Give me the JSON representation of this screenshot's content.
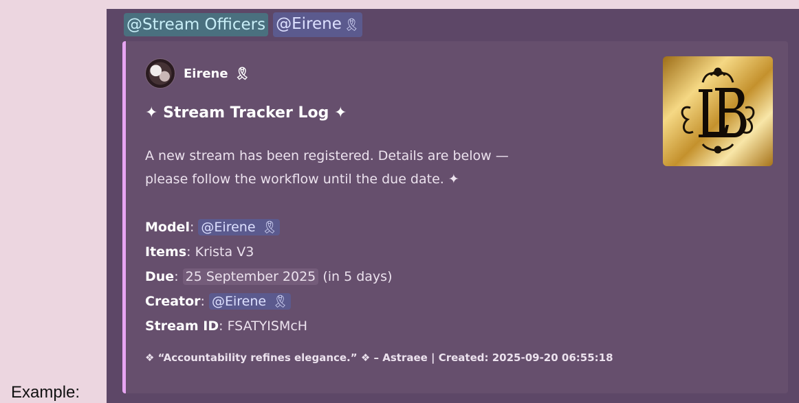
{
  "outer_label": "Example:",
  "top_mentions": {
    "role": "@Stream Officers",
    "user": "@Eirene",
    "user_badge": "🎗"
  },
  "embed": {
    "accent_color": "#e7a5f2",
    "author": {
      "name": "Eirene",
      "badge": "🎗"
    },
    "title": "✦ Stream Tracker Log ✦",
    "description_line1": "A new stream has been registered. Details are below —",
    "description_line2": "please follow the workflow until the due date. ✦",
    "fields": {
      "model_label": "Model",
      "model_value": "@Eirene",
      "model_badge": "🎗",
      "items_label": "Items",
      "items_value": "Krista V3",
      "due_label": "Due",
      "due_date": "25 September 2025",
      "due_relative": "(in 5 days)",
      "creator_label": "Creator",
      "creator_value": "@Eirene",
      "creator_badge": "🎗",
      "stream_id_label": "Stream ID",
      "stream_id_value": "FSATYISMcH"
    },
    "footer": "❖ “Accountability refines elegance.” ❖ – Astraee | Created: 2025-09-20 06:55:18",
    "thumbnail_icon": "lb-monogram-logo"
  }
}
